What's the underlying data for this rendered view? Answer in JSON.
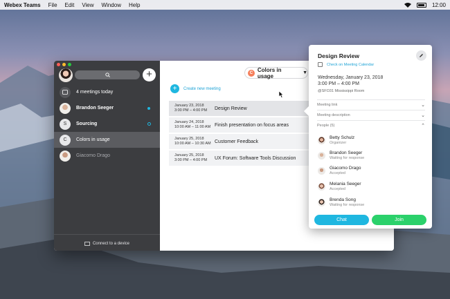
{
  "menubar": {
    "app_name": "Webex Teams",
    "menus": [
      "File",
      "Edit",
      "View",
      "Window",
      "Help"
    ],
    "clock": "12:00"
  },
  "sidebar": {
    "meetings_today": "4 meetings today",
    "items": [
      {
        "label": "Brandon Seeger",
        "initial": ""
      },
      {
        "label": "Sourcing",
        "initial": "S"
      },
      {
        "label": "Colors in usage",
        "initial": "C"
      },
      {
        "label": "Giacomo Drago",
        "initial": ""
      }
    ],
    "connect_label": "Connect to a device"
  },
  "main": {
    "space_name": "Colors in usage",
    "space_initial": "C",
    "create_meeting": "Create new meeting",
    "meetings": [
      {
        "date": "January 23, 2018",
        "time": "3:00 PM – 4:00 PM",
        "title": "Design Review"
      },
      {
        "date": "January 24, 2018",
        "time": "10:00 AM – 11:00 AM",
        "title": "Finish presentation on focus areas"
      },
      {
        "date": "January 25, 2018",
        "time": "10:00 AM – 10:30 AM",
        "title": "Customer Feedback"
      },
      {
        "date": "January 25, 2018",
        "time": "3:00 PM – 4:00 PM",
        "title": "UX Forum: Software Tools Discussion"
      }
    ]
  },
  "popover": {
    "title": "Design Review",
    "calendar_link": "Check on Meeting Calendar",
    "date": "Wednesday, January 23, 2018",
    "time": "3:00 PM – 4:00 PM",
    "location": "@SFO31 Mississippi Room",
    "sections": [
      "Meeting link",
      "Meeting description",
      "People (5)"
    ],
    "people": [
      {
        "name": "Betty Schulz",
        "status": "Organizer"
      },
      {
        "name": "Brandon Seeger",
        "status": "Waiting for response"
      },
      {
        "name": "Giacomo Drago",
        "status": "Accepted"
      },
      {
        "name": "Melania Seeger",
        "status": "Accepted"
      },
      {
        "name": "Brenda Song",
        "status": "Waiting for response"
      }
    ],
    "chat_label": "Chat",
    "join_label": "Join"
  },
  "colors": {
    "accent_blue": "#1fb7e0",
    "join_green": "#2bd16b",
    "sidebar_bg": "#3c3d40"
  }
}
